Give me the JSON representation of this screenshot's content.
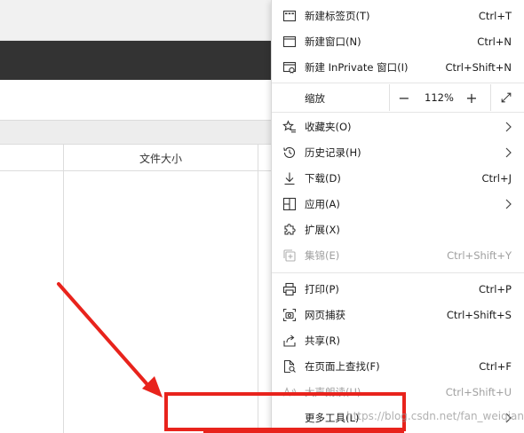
{
  "background_page": {
    "column_header": "文件大小"
  },
  "menu": {
    "items": [
      {
        "key": "new_tab",
        "label": "新建标签页(T)",
        "shortcut": "Ctrl+T",
        "icon": "new-tab-icon"
      },
      {
        "key": "new_window",
        "label": "新建窗口(N)",
        "shortcut": "Ctrl+N",
        "icon": "new-window-icon"
      },
      {
        "key": "new_inprivate",
        "label": "新建 InPrivate 窗口(I)",
        "shortcut": "Ctrl+Shift+N",
        "icon": "inprivate-icon"
      },
      {
        "key": "favorites",
        "label": "收藏夹(O)",
        "shortcut": "",
        "icon": "favorites-star-icon"
      },
      {
        "key": "history",
        "label": "历史记录(H)",
        "shortcut": "",
        "icon": "history-clock-icon"
      },
      {
        "key": "downloads",
        "label": "下载(D)",
        "shortcut": "Ctrl+J",
        "icon": "download-arrow-icon"
      },
      {
        "key": "apps",
        "label": "应用(A)",
        "shortcut": "",
        "icon": "apps-grid-icon"
      },
      {
        "key": "extensions",
        "label": "扩展(X)",
        "shortcut": "",
        "icon": "puzzle-piece-icon"
      },
      {
        "key": "collections",
        "label": "集锦(E)",
        "shortcut": "Ctrl+Shift+Y",
        "icon": "collections-icon",
        "disabled": true
      },
      {
        "key": "print",
        "label": "打印(P)",
        "shortcut": "Ctrl+P",
        "icon": "printer-icon"
      },
      {
        "key": "web_capture",
        "label": "网页捕获",
        "shortcut": "Ctrl+Shift+S",
        "icon": "web-capture-icon"
      },
      {
        "key": "share",
        "label": "共享(R)",
        "shortcut": "",
        "icon": "share-icon"
      },
      {
        "key": "find_on_page",
        "label": "在页面上查找(F)",
        "shortcut": "Ctrl+F",
        "icon": "find-on-page-icon"
      },
      {
        "key": "read_aloud",
        "label": "大声朗读(U)",
        "shortcut": "Ctrl+Shift+U",
        "icon": "read-aloud-icon",
        "disabled": true
      },
      {
        "key": "more_tools",
        "label": "更多工具(L)",
        "shortcut": "",
        "icon": "more-tools-icon"
      }
    ],
    "zoom": {
      "label": "缩放",
      "decrease": "−",
      "value": "112%",
      "increase": "+"
    }
  },
  "watermark": "https://blog.csdn.net/fan_weiqiang"
}
